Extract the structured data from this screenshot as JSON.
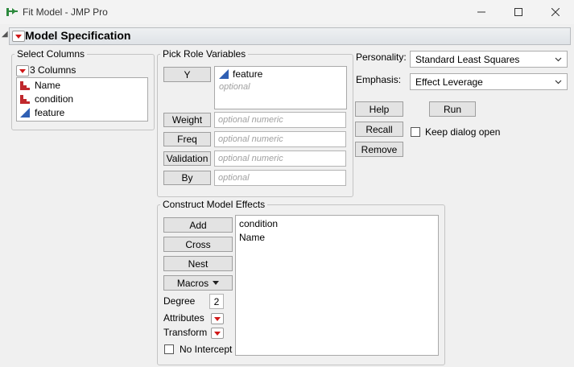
{
  "window": {
    "title": "Fit Model - JMP Pro",
    "controls": {
      "minimize": "—",
      "maximize": "☐",
      "close": "✕"
    }
  },
  "header": {
    "title": "Model Specification"
  },
  "select_columns": {
    "label": "Select Columns",
    "count_label": "3 Columns",
    "columns": [
      {
        "name": "Name",
        "icon": "nominal-bar-icon"
      },
      {
        "name": "condition",
        "icon": "nominal-bar-icon"
      },
      {
        "name": "feature",
        "icon": "continuous-triangle-icon"
      }
    ]
  },
  "roles": {
    "label": "Pick Role Variables",
    "y": {
      "button": "Y",
      "value": "feature",
      "placeholder": "optional"
    },
    "weight": {
      "button": "Weight",
      "placeholder": "optional numeric"
    },
    "freq": {
      "button": "Freq",
      "placeholder": "optional numeric"
    },
    "validation": {
      "button": "Validation",
      "placeholder": "optional numeric"
    },
    "by": {
      "button": "By",
      "placeholder": "optional"
    }
  },
  "options": {
    "personality_label": "Personality:",
    "personality_value": "Standard Least Squares",
    "emphasis_label": "Emphasis:",
    "emphasis_value": "Effect Leverage",
    "help": "Help",
    "run": "Run",
    "recall": "Recall",
    "remove": "Remove",
    "keep_open": "Keep dialog open"
  },
  "effects": {
    "label": "Construct Model Effects",
    "add": "Add",
    "cross": "Cross",
    "nest": "Nest",
    "macros": "Macros",
    "degree_label": "Degree",
    "degree_value": "2",
    "attributes_label": "Attributes",
    "transform_label": "Transform",
    "no_intercept": "No Intercept",
    "items": [
      "condition",
      "Name"
    ]
  },
  "colors": {
    "accent_red": "#d01818",
    "continuous_blue": "#2f5fb3",
    "nominal_red": "#c0282d"
  }
}
